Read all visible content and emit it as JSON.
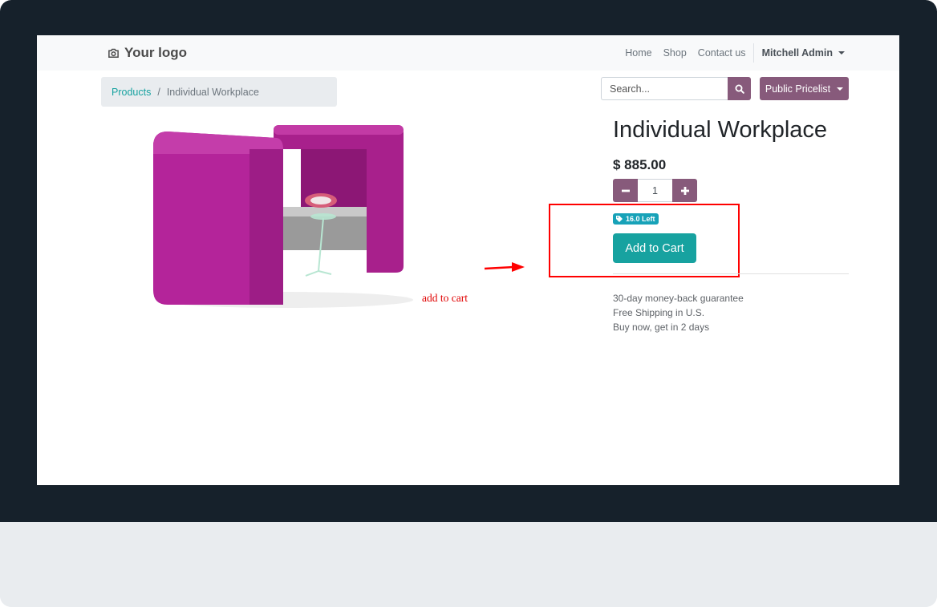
{
  "navbar": {
    "logo_text": "Your logo",
    "links": [
      "Home",
      "Shop",
      "Contact us"
    ],
    "user_name": "Mitchell Admin"
  },
  "breadcrumb": {
    "parent": "Products",
    "separator": "/",
    "current": "Individual Workplace"
  },
  "search": {
    "placeholder": "Search..."
  },
  "pricelist": {
    "label": "Public Pricelist"
  },
  "product": {
    "name": "Individual Workplace",
    "price": "$ 885.00",
    "quantity": "1",
    "stock_badge": "16.0 Left",
    "add_to_cart_label": "Add to Cart",
    "guarantees": [
      "30-day money-back guarantee",
      "Free Shipping in U.S.",
      "Buy now, get in 2 days"
    ]
  },
  "annotation": {
    "label": "add to cart",
    "color": "#ff0000"
  },
  "colors": {
    "primary": "#875a7b",
    "accent": "#17a2a0",
    "badge": "#17a2b8",
    "bezel": "#16212b"
  },
  "icons": [
    "camera-icon",
    "search-icon",
    "tag-icon",
    "minus-icon",
    "plus-icon",
    "caret-down-icon"
  ]
}
